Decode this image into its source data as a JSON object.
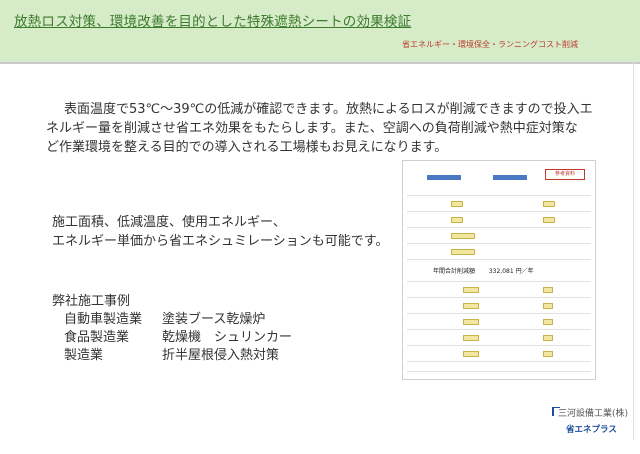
{
  "header": {
    "title": "放熱ロス対策、環境改善を目的とした特殊遮熱シートの効果検証",
    "subtitle": "省エネルギー・環境保全・ランニングコスト削減"
  },
  "paragraph": [
    "表面温度で53℃～39℃の低減が確認できます。放熱によるロスが削減できますので投入エ",
    "ネルギー量を削減させ省エネ効果をもたらします。また、空調への負荷削減や熱中症対策な",
    "ど作業環境を整える目的での導入される工場様もお見えになります。"
  ],
  "simulation": [
    "施工面積、低減温度、使用エネルギー、",
    "エネルギー単価から省エネシュミレーションも可能です。"
  ],
  "cases": {
    "heading": "弊社施工事例",
    "rows": [
      {
        "industry": "自動車製造業",
        "content": "塗装ブース乾燥炉"
      },
      {
        "industry": "食品製造業",
        "content": "乾燥機　シュリンカー"
      },
      {
        "industry": "製造業",
        "content": "折半屋根侵入熱対策"
      }
    ]
  },
  "sheet_image": {
    "badge": "参考資料",
    "annual_label": "年間合計削減額",
    "annual_value": "332,081",
    "annual_unit": "円／年"
  },
  "logo": {
    "company": "三河設備工業(株)",
    "brand": "省エネプラス"
  },
  "colors": {
    "header_bg": "#d6ecc9",
    "title": "#3a7a2a",
    "subtitle": "#c0392b",
    "brand": "#1f4e9c"
  }
}
